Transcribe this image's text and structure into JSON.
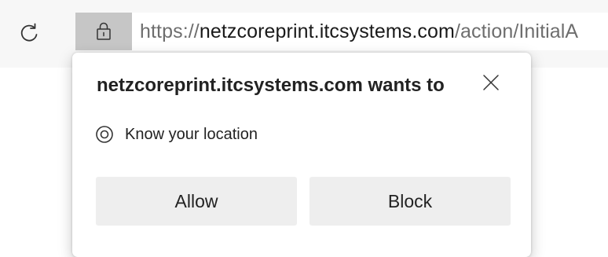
{
  "toolbar": {
    "refresh_icon": "refresh-icon",
    "lock_icon": "lock-icon",
    "url_scheme": "https://",
    "url_host": "netzcoreprint.itcsystems.com",
    "url_path": "/action/InitialA"
  },
  "permission_prompt": {
    "title": "netzcoreprint.itcsystems.com wants to",
    "close_icon": "close-icon",
    "permission_icon": "location-icon",
    "permission_label": "Know your location",
    "allow_label": "Allow",
    "block_label": "Block"
  },
  "colors": {
    "toolbar_bg": "#f7f7f7",
    "lock_button_bg": "#c6c6c6",
    "button_bg": "#eeeeee",
    "url_host_text": "#1a1a1a",
    "url_secondary_text": "#6e6e6e"
  }
}
